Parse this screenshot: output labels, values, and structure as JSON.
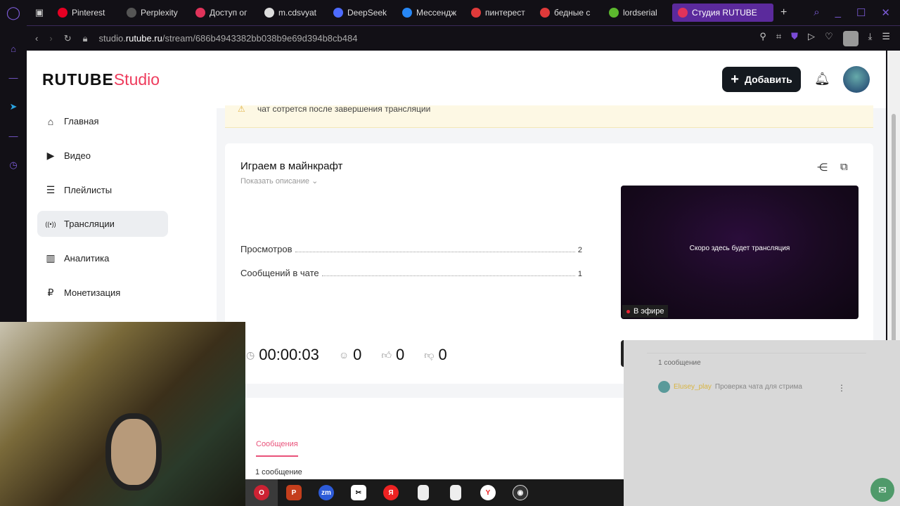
{
  "browser": {
    "tabs": [
      {
        "label": "Pinterest",
        "color": "#e60023"
      },
      {
        "label": "Perplexity",
        "color": "#555"
      },
      {
        "label": "Доступ ог",
        "color": "#e0335a"
      },
      {
        "label": "m.cdsvyat",
        "color": "#ddd"
      },
      {
        "label": "DeepSeek",
        "color": "#4d6bfe"
      },
      {
        "label": "Мессендж",
        "color": "#2787f5"
      },
      {
        "label": "пинтерест",
        "color": "#e03a3a"
      },
      {
        "label": "бедные с",
        "color": "#e03a3a"
      },
      {
        "label": "lordserial",
        "color": "#5cb82e"
      },
      {
        "label": "Студия RUTUBE",
        "color": "#e0335a"
      }
    ],
    "url_prefix": "studio.",
    "url_domain": "rutube.ru",
    "url_path": "/stream/686b4943382bb038b9e69d394b8cb484"
  },
  "header": {
    "logo_main": "RUTUBE",
    "logo_sub": "Studio",
    "add_label": "Добавить"
  },
  "nav": [
    {
      "label": "Главная",
      "icon": "home-icon"
    },
    {
      "label": "Видео",
      "icon": "video-icon"
    },
    {
      "label": "Плейлисты",
      "icon": "playlist-icon"
    },
    {
      "label": "Трансляции",
      "icon": "broadcast-icon"
    },
    {
      "label": "Аналитика",
      "icon": "analytics-icon"
    },
    {
      "label": "Монетизация",
      "icon": "ruble-icon"
    }
  ],
  "warning": "чат сотрется после завершения трансляции",
  "stream": {
    "title": "Играем в майнкрафт",
    "show_description": "Показать описание",
    "stats": [
      {
        "label": "Просмотров",
        "value": "2"
      },
      {
        "label": "Сообщений в чате",
        "value": "1"
      }
    ],
    "preview_text": "Скоро здесь будет трансляция",
    "live_badge": "В эфире",
    "duration": "00:00:03",
    "viewers": "0",
    "likes": "0",
    "dislikes": "0"
  },
  "messages_tab": "Сообщения",
  "messages_count": "1 сообщение",
  "chat": {
    "count": "1 сообщение",
    "messages": [
      {
        "user": "Elusey_play",
        "text": "Проверка чата для стрима"
      }
    ]
  }
}
